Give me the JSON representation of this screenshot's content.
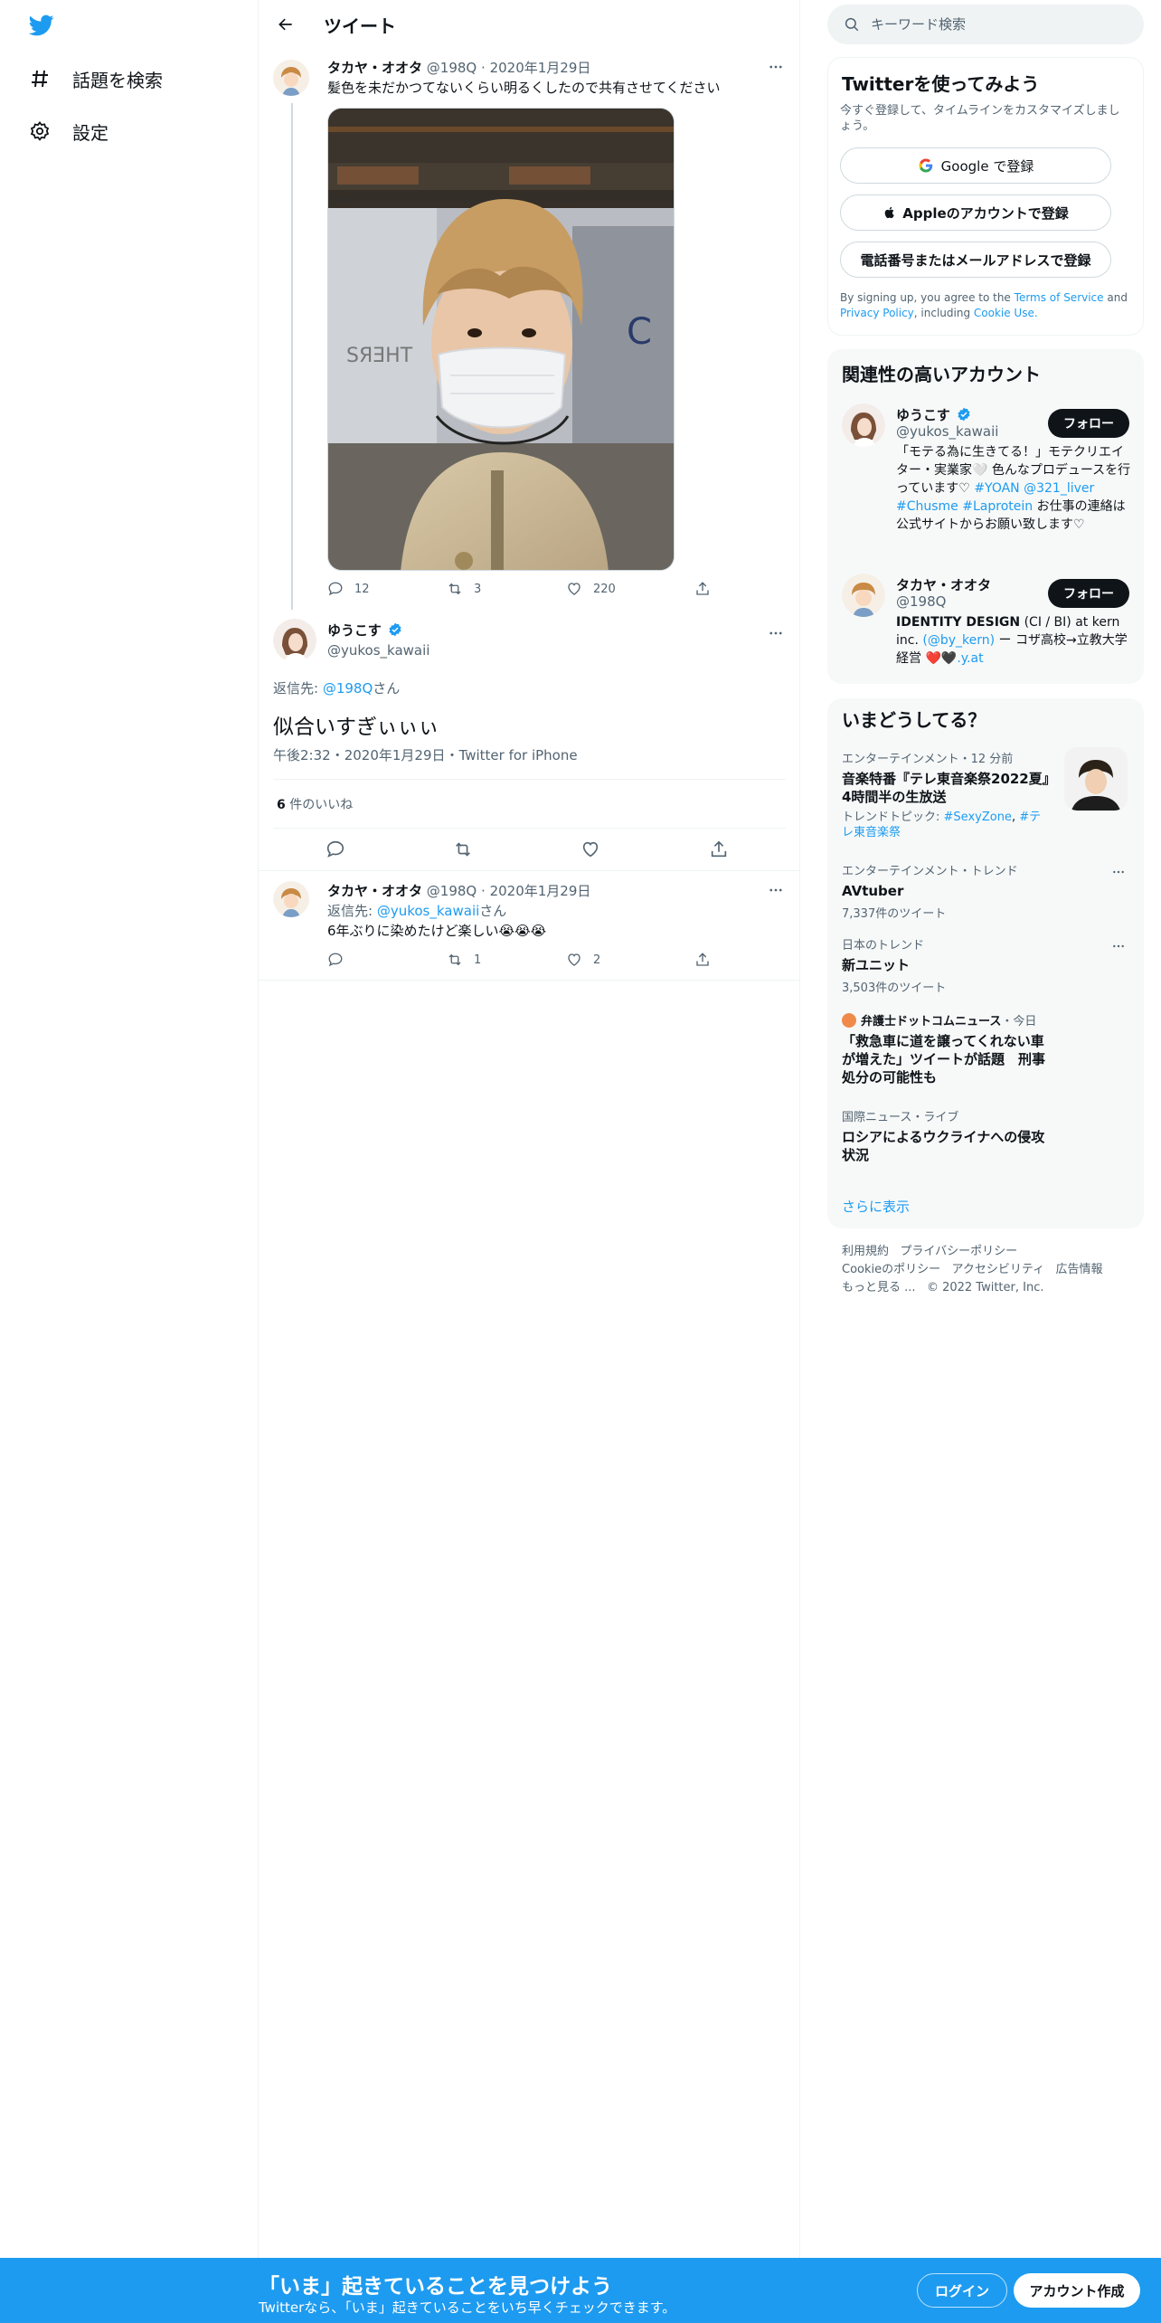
{
  "nav": {
    "items": [
      {
        "label": "話題を検索",
        "icon": "hashtag-icon"
      },
      {
        "label": "設定",
        "icon": "gear-icon"
      }
    ]
  },
  "header": {
    "title": "ツイート"
  },
  "parent_tweet": {
    "name": "タカヤ・オオタ",
    "handle": "@198Q",
    "date": "2020年1月29日",
    "text": "髪色を未だかつてないくらい明るくしたので共有させてください",
    "replies": "12",
    "retweets": "3",
    "likes": "220"
  },
  "main_tweet": {
    "name": "ゆうこす",
    "handle": "@yukos_kawaii",
    "reply_label": "返信先:",
    "reply_to": "@198Q",
    "reply_suffix": "さん",
    "text": "似合いすぎぃぃぃ",
    "time": "午後2:32",
    "date": "2020年1月29日",
    "source": "Twitter for iPhone",
    "like_count": "6",
    "like_label": "件のいいね"
  },
  "reply_tweet": {
    "name": "タカヤ・オオタ",
    "handle": "@198Q",
    "date": "2020年1月29日",
    "reply_label": "返信先:",
    "reply_to": "@yukos_kawaii",
    "reply_suffix": "さん",
    "text": "6年ぶりに染めたけど楽しい😭😭😭",
    "replies": "",
    "retweets": "1",
    "likes": "2"
  },
  "search": {
    "placeholder": "キーワード検索"
  },
  "signup": {
    "title": "Twitterを使ってみよう",
    "subtitle": "今すぐ登録して、タイムラインをカスタマイズしましょう。",
    "google": "Google で登録",
    "apple": "Appleのアカウントで登録",
    "phone": "電話番号またはメールアドレスで登録",
    "legal_1": "By signing up, you agree to the",
    "terms": "Terms of Service",
    "legal_2": "and",
    "privacy": "Privacy Policy",
    "legal_3": ", including",
    "cookie": "Cookie Use."
  },
  "related": {
    "title": "関連性の高いアカウント",
    "follow_label": "フォロー",
    "accounts": [
      {
        "name": "ゆうこす",
        "handle": "@yukos_kawaii",
        "bio_1": "「モテる為に生きてる！」モテクリエイター・実業家🤍 色んなプロデュースを行っています♡",
        "tag_1": "#YOAN",
        "tag_2": "@321_liver",
        "tag_3": "#Chusme",
        "tag_4": "#Laprotein",
        "bio_2": "お仕事の連絡は公式サイトからお願い致します♡"
      },
      {
        "name": "タカヤ・オオタ",
        "handle": "@198Q",
        "bio_1": "IDENTITY DESIGN",
        "bio_2": "(CI / BI) at kern inc.",
        "link_1": "(@by_kern)",
        "bio_3": "ー コザ高校→立教大学経営",
        "link_2": "❤️🖤.y.at"
      }
    ]
  },
  "trends": {
    "title": "いまどうしてる？",
    "items": [
      {
        "context": "エンターテインメント・12 分前",
        "title": "音楽特番『テレ東音楽祭2022夏』4時間半の生放送",
        "topic_label": "トレンドトピック:",
        "topic_1": "#SexyZone",
        "topic_2": "#テレ東音楽祭"
      },
      {
        "context": "エンターテインメント・トレンド",
        "title": "AVtuber",
        "count": "7,337件のツイート"
      },
      {
        "context": "日本のトレンド",
        "title": "新ユニット",
        "count": "3,503件のツイート"
      },
      {
        "source": "弁護士ドットコムニュース",
        "time": "・今日",
        "title": "「救急車に道を譲ってくれない車が増えた」ツイートが話題　刑事処分の可能性も"
      },
      {
        "context": "国際ニュース・ライブ",
        "title": "ロシアによるウクライナへの侵攻状況"
      }
    ],
    "show_more": "さらに表示"
  },
  "footer": {
    "links_1": [
      "利用規約",
      "プライバシーポリシー"
    ],
    "links_2": [
      "Cookieのポリシー",
      "アクセシビリティ",
      "広告情報"
    ],
    "more": "もっと見る ...",
    "copyright": "© 2022 Twitter, Inc."
  },
  "bottom_bar": {
    "title": "「いま」起きていることを見つけよう",
    "subtitle": "Twitterなら、「いま」起きていることをいち早くチェックできます。",
    "login": "ログイン",
    "signup": "アカウント作成"
  },
  "colors": {
    "accent": "#1d9bf0",
    "text": "#0f1419",
    "muted": "#536471",
    "panel": "#f7f9f9"
  }
}
